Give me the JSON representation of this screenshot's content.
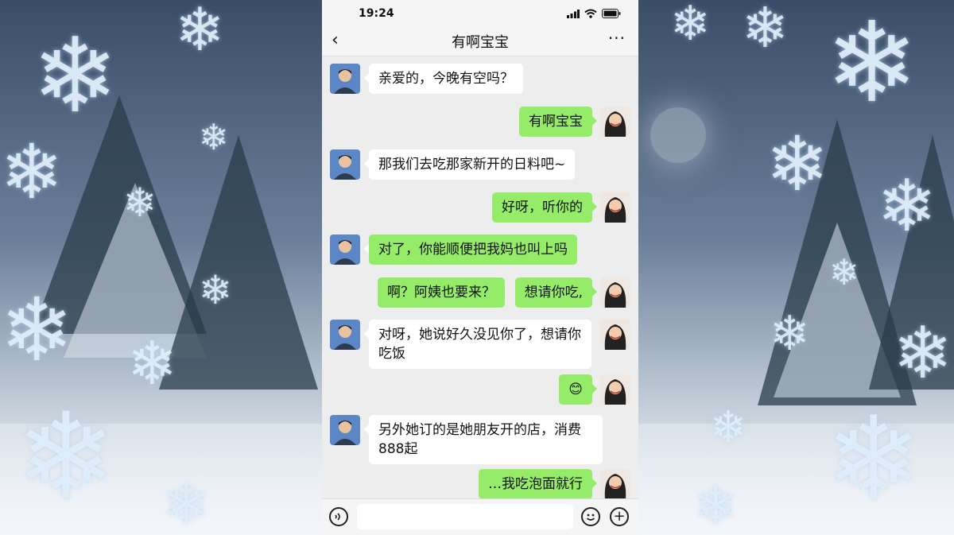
{
  "status_bar": {
    "time": "19:24"
  },
  "header": {
    "back_icon": "‹",
    "title": "有啊宝宝",
    "more_icon": "···"
  },
  "messages": [
    {
      "side": "in",
      "text": "亲爱的，今晚有空吗？"
    },
    {
      "side": "out",
      "text": "有啊宝宝"
    },
    {
      "side": "in",
      "text": "那我们去吃那家新开的日料吧~"
    },
    {
      "side": "out",
      "text": "好呀，听你的"
    },
    {
      "side": "in",
      "text": "对了，你能顺便把我妈也叫上吗"
    },
    {
      "side": "out",
      "text": "啊？阿姨也要来？",
      "text2": "想请你吃,"
    },
    {
      "side": "in",
      "text": "对呀，她说好久没见你了，想请你吃饭"
    },
    {
      "side": "out",
      "text": "😊"
    },
    {
      "side": "in",
      "text": "另外她订的是她朋友开的店，消费888起"
    },
    {
      "side": "out",
      "text": "…我吃泡面就行"
    }
  ],
  "input_bar": {
    "placeholder": "",
    "voice_icon": "voice-icon",
    "emoji_icon": "emoji-icon",
    "plus_icon": "plus-icon"
  },
  "colors": {
    "outgoing_bubble": "#95ec69",
    "incoming_bubble": "#ffffff",
    "chat_background": "#ededed"
  }
}
